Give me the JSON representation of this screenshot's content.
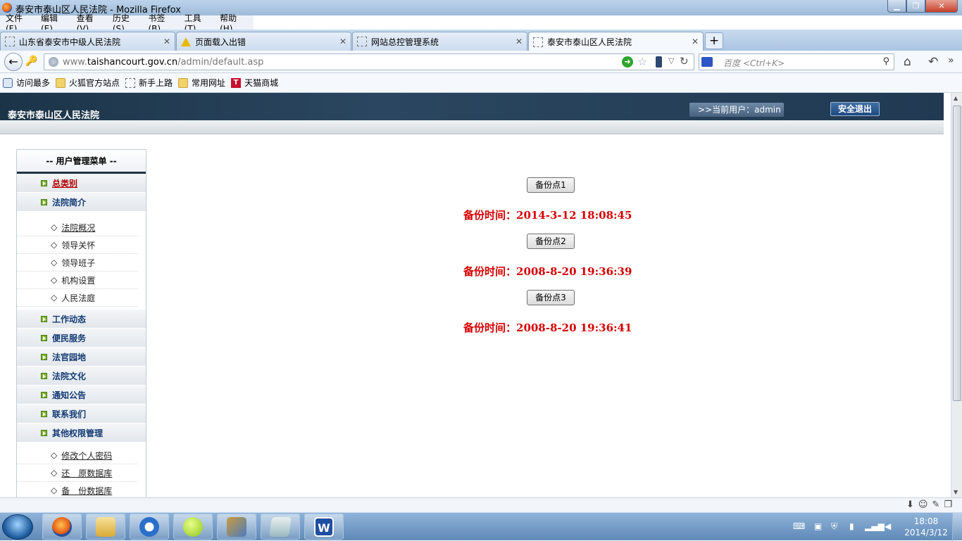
{
  "window": {
    "title": "泰安市泰山区人民法院 - Mozilla Firefox"
  },
  "menubar": [
    "文件(F)",
    "编辑(E)",
    "查看(V)",
    "历史(S)",
    "书签(B)",
    "工具(T)",
    "帮助(H)"
  ],
  "tabs": [
    {
      "label": "山东省泰安市中级人民法院",
      "icon": "page-icon"
    },
    {
      "label": "页面载入出错",
      "icon": "warning-icon"
    },
    {
      "label": "网站总控管理系统",
      "icon": "page-icon"
    },
    {
      "label": "泰安市泰山区人民法院",
      "icon": "page-icon",
      "active": true
    }
  ],
  "urlbar": {
    "prefix": "www.",
    "domain": "taishancourt.gov.cn",
    "path": "/admin/default.asp"
  },
  "search": {
    "placeholder": "百度 <Ctrl+K>"
  },
  "bookmarks": [
    {
      "label": "访问最多",
      "icon": "most-visited-icon"
    },
    {
      "label": "火狐官方站点",
      "icon": "folder-icon"
    },
    {
      "label": "新手上路",
      "icon": "page-icon"
    },
    {
      "label": "常用网址",
      "icon": "folder-icon"
    },
    {
      "label": "天猫商城",
      "icon": "tmall-icon"
    }
  ],
  "header": {
    "site_name": "泰安市泰山区人民法院",
    "current_user": ">>当前用户：admin",
    "logout": "安全退出"
  },
  "sidemenu": {
    "title": "-- 用户管理菜单 --",
    "items": [
      {
        "label": "总类别"
      },
      {
        "label": "法院简介",
        "children": [
          "法院概况",
          "领导关怀",
          "领导班子",
          "机构设置",
          "人民法庭"
        ]
      },
      {
        "label": "工作动态"
      },
      {
        "label": "便民服务"
      },
      {
        "label": "法官园地"
      },
      {
        "label": "法院文化"
      },
      {
        "label": "通知公告"
      },
      {
        "label": "联系我们"
      },
      {
        "label": "其他权限管理",
        "children": [
          "修改个人密码",
          "还　原数据库",
          "备　份数据库"
        ]
      }
    ]
  },
  "backups": [
    {
      "button": "备份点1",
      "time": "备份时间：2014-3-12 18:08:45"
    },
    {
      "button": "备份点2",
      "time": "备份时间：2008-8-20 19:36:39"
    },
    {
      "button": "备份点3",
      "time": "备份时间：2008-8-20 19:36:41"
    }
  ],
  "taskbar": {
    "apps": [
      "firefox-icon",
      "explorer-icon",
      "sogou-icon",
      "green-ball-icon",
      "tool-icon",
      "notepad-icon",
      "word-icon"
    ],
    "time": "18:08",
    "date": "2014/3/12"
  },
  "colors": {
    "header_bg": "#1c3448",
    "backup_time": "#d50000",
    "menu_link": "#133a74"
  }
}
